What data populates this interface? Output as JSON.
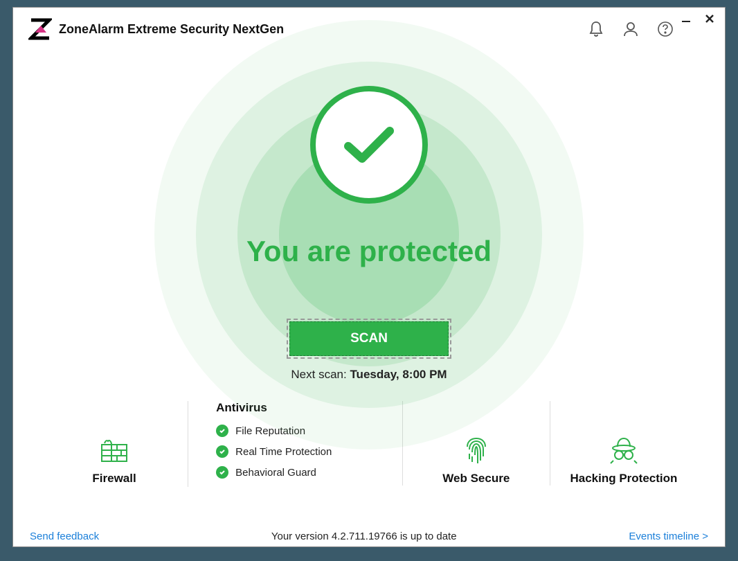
{
  "app": {
    "title": "ZoneAlarm Extreme Security NextGen"
  },
  "status": {
    "headline": "You are protected"
  },
  "scan": {
    "button_label": "SCAN",
    "next_prefix": "Next scan: ",
    "next_value": "Tuesday, 8:00 PM"
  },
  "features": {
    "firewall": "Firewall",
    "antivirus_title": "Antivirus",
    "antivirus_items": {
      "0": "File Reputation",
      "1": "Real Time Protection",
      "2": "Behavioral Guard"
    },
    "web_secure": "Web Secure",
    "hacking_protection": "Hacking Protection"
  },
  "footer": {
    "feedback": "Send feedback",
    "version": "Your version 4.2.711.19766 is up to date",
    "timeline": "Events timeline >"
  },
  "colors": {
    "accent": "#2eb14a",
    "link": "#1b7fd9"
  }
}
